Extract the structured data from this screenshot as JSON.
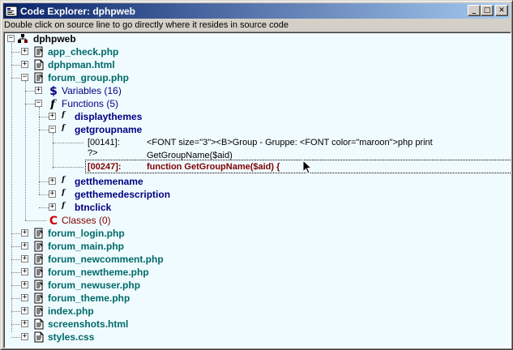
{
  "window": {
    "title": "Code Explorer: dphpweb",
    "minimize_glyph": "_",
    "maximize_glyph": "□",
    "close_glyph": "✕"
  },
  "hint": "Double click on source line to go directly where it resides in source code",
  "tree": {
    "root": "dphpweb",
    "files_top": [
      "app_check.php",
      "dphpman.html"
    ],
    "open_file": "forum_group.php",
    "variables_label": "Variables (16)",
    "functions_label": "Functions (5)",
    "functions": [
      "displaythemes",
      "getgroupname",
      "getthemename",
      "getthemedescription",
      "btnclick"
    ],
    "source_lines": [
      {
        "line": "[00141]:",
        "code": "<FONT size=\"3\"><B>Group - Gruppe: <FONT color=\"maroon\">php print GetGroupName($aid)",
        "code_cont": "?>"
      },
      {
        "line": "[00247]:",
        "code": "function GetGroupName($aid) {"
      }
    ],
    "classes_label": "Classes (0)",
    "files_bottom": [
      "forum_login.php",
      "forum_main.php",
      "forum_newcomment.php",
      "forum_newtheme.php",
      "forum_newuser.php",
      "forum_theme.php",
      "index.php",
      "screenshots.html",
      "styles.css"
    ],
    "func_marker": "f",
    "expand_plus": "+",
    "expand_minus": "−"
  },
  "colors": {
    "title_gradient_start": "#0a246a",
    "title_gradient_end": "#a6caf0",
    "tree_background": "#f0fbff",
    "file_text": "#006a6a",
    "function_text": "#000080",
    "highlight_source": "#800000"
  },
  "icons": {
    "root": "project-icon",
    "php_file": "php-file-icon",
    "html_file": "html-file-icon",
    "variables": "dollar-icon",
    "functions": "function-icon",
    "classes": "class-icon"
  }
}
